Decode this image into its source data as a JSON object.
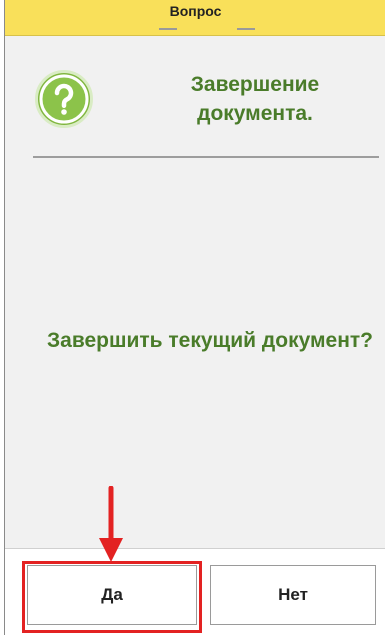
{
  "dialog": {
    "title": "Вопрос",
    "header_title": "Завершение документа.",
    "message": "Завершить текущий документ?"
  },
  "buttons": {
    "yes_label": "Да",
    "no_label": "Нет"
  },
  "icons": {
    "question": "question-mark-icon",
    "annotation_arrow": "arrow-down-icon"
  },
  "colors": {
    "title_bar": "#f9e05a",
    "accent_text": "#4a7c2a",
    "icon_green": "#8cc34a",
    "annotation_red": "#e32222"
  }
}
